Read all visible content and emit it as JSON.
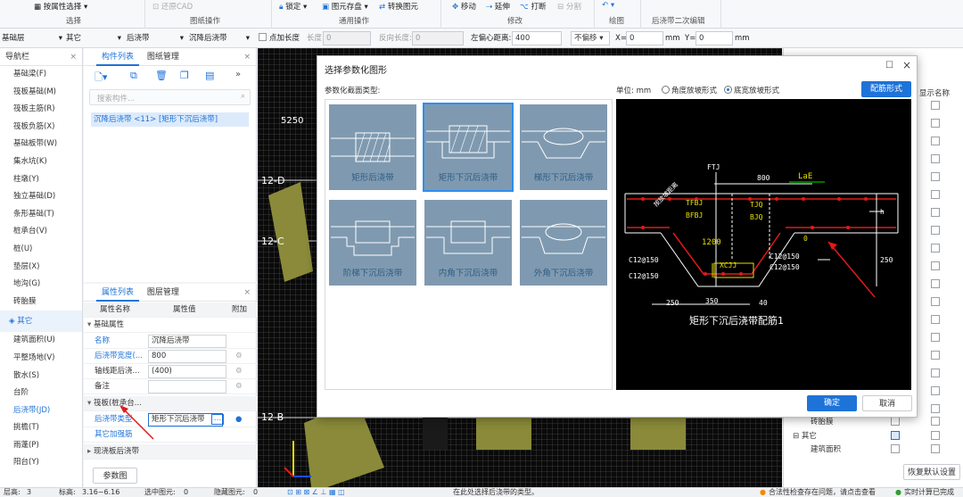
{
  "ribbon": {
    "select_by_attr": "按属性选择",
    "group_select": "选择",
    "restore_cad": "还原CAD",
    "group_drawing": "图纸操作",
    "lock": "锁定",
    "save_element": "图元存盘",
    "convert_element": "转换图元",
    "group_general": "通用操作",
    "move": "移动",
    "extend": "延伸",
    "break": "打断",
    "split": "分割",
    "group_modify": "修改",
    "group_draw": "绘图",
    "group_secondary": "后浇带二次编辑"
  },
  "toolbar": {
    "floor": "基础层",
    "category": "其它",
    "type": "后浇带",
    "component": "沉降后浇带",
    "point_length_label": "点加长度",
    "length_label": "长度:",
    "length_value": "0",
    "reverse_length_label": "反向长度:",
    "reverse_length_value": "0",
    "offset_label": "左偏心距离:",
    "offset_value": "400",
    "no_offset": "不偏移",
    "x_label": "X=",
    "x_value": "0",
    "y_label": "Y=",
    "y_value": "0",
    "unit": "mm"
  },
  "nav": {
    "title": "导航栏",
    "items": [
      "基础梁(F)",
      "筏板基础(M)",
      "筏板主筋(R)",
      "筏板负筋(X)",
      "基础板带(W)",
      "集水坑(K)",
      "柱墩(Y)",
      "独立基础(D)",
      "条形基础(T)",
      "桩承台(V)",
      "桩(U)",
      "垫层(X)",
      "地沟(G)",
      "砖胎膜"
    ],
    "section": "其它",
    "sub_items": [
      "建筑面积(U)",
      "平整场地(V)",
      "散水(S)",
      "台阶",
      "后浇带(JD)",
      "挑檐(T)",
      "雨蓬(P)",
      "阳台(Y)"
    ]
  },
  "component_panel": {
    "tab_list": "构件列表",
    "tab_drawing": "图纸管理",
    "search_placeholder": "搜索构件...",
    "item": "沉降后浇带 <11> [矩形下沉后浇带]"
  },
  "property_panel": {
    "tab_props": "属性列表",
    "tab_layers": "图层管理",
    "col_name": "属性名称",
    "col_value": "属性值",
    "col_attach": "附加",
    "section_basic": "基础属性",
    "rows": [
      {
        "name": "名称",
        "value": "沉降后浇带"
      },
      {
        "name": "后浇带宽度(...",
        "value": "800"
      },
      {
        "name": "轴线距后浇...",
        "value": "(400)"
      },
      {
        "name": "备注",
        "value": ""
      }
    ],
    "section_raft": "筏板(桩承台...",
    "raft_type_label": "后浇带类型",
    "raft_type_value": "矩形下沉后浇带",
    "extra_rebar": "其它加强筋",
    "section_cast": "现浇板后浇带",
    "param_button": "参数图"
  },
  "canvas": {
    "axis_labels": [
      "12-D",
      "12-C",
      "12-B"
    ],
    "number": "5250"
  },
  "right_panel": {
    "col_display": "显示名称",
    "items": [
      "砖胎膜",
      "其它",
      "建筑面积"
    ],
    "restore_button": "恢复默认设置"
  },
  "dialog": {
    "title": "选择参数化图形",
    "section_label": "参数化截面类型:",
    "unit_label": "单位: mm",
    "radio_angle": "角度放坡形式",
    "radio_width": "底宽放坡形式",
    "rebar_form_button": "配筋形式",
    "shapes": [
      "矩形后浇带",
      "矩形下沉后浇带",
      "梯形下沉后浇带",
      "阶梯下沉后浇带",
      "内角下沉后浇带",
      "外角下沉后浇带"
    ],
    "diagram": {
      "caption": "矩形下沉后浇带配筋1",
      "labels": {
        "ftj": "FTJ",
        "w800": "800",
        "lae": "LaE",
        "tfbj": "TFBJ",
        "bfbj": "BFBJ",
        "tjq": "TJQ",
        "bjq": "BJQ",
        "w1200": "1200",
        "h": "h",
        "zero": "0",
        "c150a": "C12@150",
        "c150b": "C12@150",
        "c150c": "C12@150",
        "c150d": "C12@150",
        "xcjj": "XCJJ",
        "d250a": "250",
        "d350": "350",
        "d40": "40",
        "d250b": "250",
        "slope": "按放坡距离"
      }
    },
    "ok_button": "确定",
    "cancel_button": "取消"
  },
  "status": {
    "floor_height_label": "层高:",
    "floor_height": "3",
    "elevation_label": "标高:",
    "elevation": "3.16~6.16",
    "selected_label": "选中图元:",
    "selected": "0",
    "hidden_label": "隐藏图元:",
    "hidden": "0",
    "hint": "在此处选择后浇带的类型。",
    "check_msg": "合法性检查存在问题，请点击查看",
    "calc_msg": "实时计算已完成"
  }
}
